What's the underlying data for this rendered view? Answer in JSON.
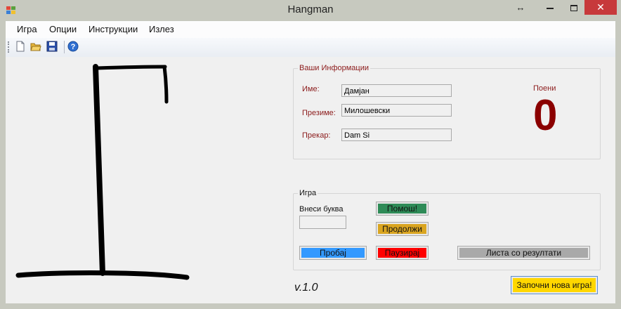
{
  "window": {
    "title": "Hangman"
  },
  "menu": [
    "Игра",
    "Опции",
    "Инструкции",
    "Излез"
  ],
  "player_info": {
    "legend": "Ваши Информации",
    "name_label": "Име:",
    "name_value": "Дамјан",
    "surname_label": "Презиме:",
    "surname_value": "Милошевски",
    "nickname_label": "Прекар:",
    "nickname_value": "Dam Si"
  },
  "score": {
    "label": "Поени",
    "value": "0"
  },
  "game": {
    "legend": "Игра",
    "letter_label": "Внеси буква",
    "letter_value": "",
    "help_button": "Помош!",
    "continue_button": "Продолжи",
    "try_button": "Пробај",
    "pause_button": "Паузирај",
    "results_button": "Листа со резултати"
  },
  "version": "v.1.0",
  "new_game_button": "Започни нова игра!",
  "colors": {
    "accent_red": "#8b1a1a",
    "help": "#2e8b57",
    "continue": "#daa520",
    "try": "#3399ff",
    "pause": "#ff0000",
    "results": "#a9a9a9",
    "new_game": "#ffd700"
  }
}
